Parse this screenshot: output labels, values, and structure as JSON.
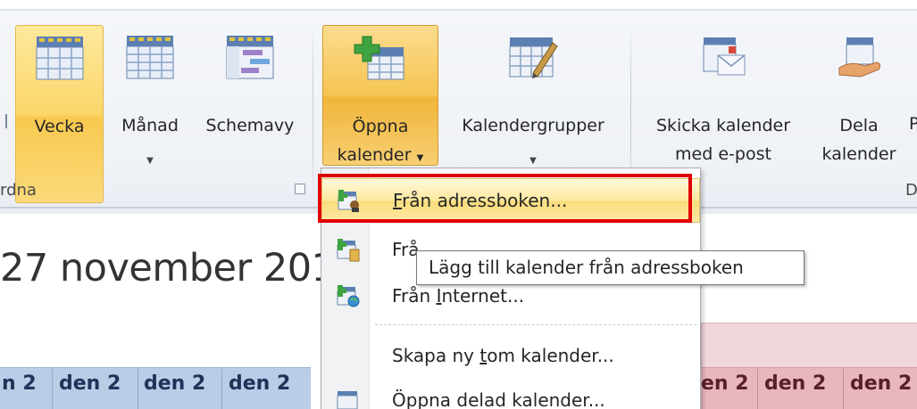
{
  "ribbon": {
    "buttons": {
      "vecka": "Vecka",
      "manad": "Månad",
      "schemavy": "Schemavy",
      "oppna_line1": "Öppna",
      "oppna_line2": "kalender",
      "kalendergrupper": "Kalendergrupper",
      "skicka_line1": "Skicka kalender",
      "skicka_line2": "med e-post",
      "dela_line1": "Dela",
      "dela_line2": "kalender",
      "next_partial": "P"
    },
    "groups": {
      "ordna": "rdna",
      "dela_partial": "D"
    }
  },
  "date_heading": "27 november 201",
  "dropdown": {
    "items": [
      {
        "before": "",
        "key": "F",
        "after": "rån adressboken..."
      },
      {
        "before": "Frå",
        "key": "",
        "after": ""
      },
      {
        "before": "Från ",
        "key": "I",
        "after": "nternet..."
      },
      {
        "before": "Skapa ny ",
        "key": "t",
        "after": "om kalender..."
      },
      {
        "before": "Öppna delad kalender...",
        "key": "",
        "after": ""
      }
    ]
  },
  "tooltip": "Lägg till kalender från adressboken",
  "calendar_cells": {
    "left": [
      "n 2",
      "den 2",
      "den 2",
      "den 2"
    ],
    "right": [
      "en 2",
      "den 2",
      "den 2"
    ]
  },
  "colors": {
    "highlight": "#e00000",
    "selected_button": "#fbd66a",
    "blue_tab": "#b9cde6",
    "pink_tab": "#e8b6bf"
  }
}
